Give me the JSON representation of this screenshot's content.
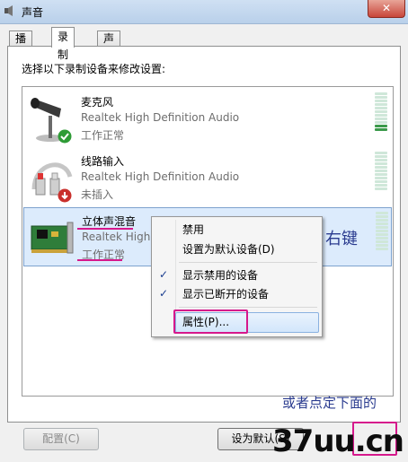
{
  "window": {
    "title": "声音",
    "close_label": "✕"
  },
  "tabs": [
    {
      "label": "播放"
    },
    {
      "label": "录制"
    },
    {
      "label": "声音"
    }
  ],
  "instruction": "选择以下录制设备来修改设置:",
  "devices": [
    {
      "name": "麦克风",
      "driver": "Realtek High Definition Audio",
      "status": "工作正常",
      "icon": "microphone-icon",
      "badge": "check-badge"
    },
    {
      "name": "线路输入",
      "driver": "Realtek High Definition Audio",
      "status": "未插入",
      "icon": "line-in-cable-icon",
      "badge": "down-arrow-badge"
    },
    {
      "name": "立体声混音",
      "driver": "Realtek High",
      "status": "工作正常",
      "icon": "sound-card-icon"
    }
  ],
  "context_menu": {
    "items": [
      {
        "label": "禁用",
        "checked": false
      },
      {
        "label": "设置为默认设备(D)",
        "checked": false
      },
      {
        "label": "显示禁用的设备",
        "checked": true
      },
      {
        "label": "显示已断开的设备",
        "checked": true
      },
      {
        "label": "属性(P)...",
        "checked": false
      }
    ],
    "check_glyph": "✓"
  },
  "annotations": {
    "right_click": "右键",
    "or_click_below": "或者点定下面的"
  },
  "buttons": {
    "configure": "配置(C)",
    "set_default": "设为默认(S)"
  },
  "watermark": "37uu.cn",
  "colors": {
    "selection_bg": "#dcebfc",
    "annotation_magenta": "#d6188c",
    "meter_green": "#3c9a4b"
  }
}
